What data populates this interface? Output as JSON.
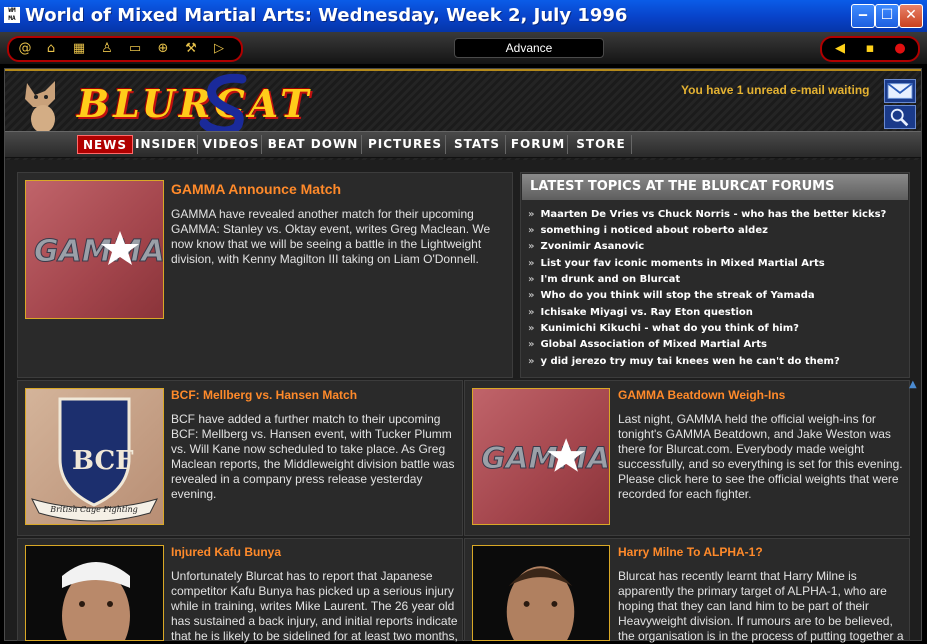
{
  "window": {
    "title": "World of Mixed Martial Arts: Wednesday, Week 2, July 1996",
    "app_icon_text": "WM MA",
    "minimize": "‒",
    "maximize": "☐",
    "close": "✕"
  },
  "toolbar": {
    "left_icons": [
      "at-icon",
      "home-icon",
      "building-icon",
      "person-icon",
      "monitor-icon",
      "globe-icon",
      "tools-icon",
      "play-icon"
    ],
    "left_glyphs": [
      "@",
      "⌂",
      "▦",
      "♙",
      "▭",
      "⊕",
      "⚒",
      "▷"
    ],
    "advance_label": "Advance",
    "right_glyphs": [
      "◀",
      "▪",
      "●"
    ]
  },
  "banner": {
    "logo_text": "BLURCAT",
    "email_notice": "You have 1 unread e-mail waiting"
  },
  "nav": {
    "items": [
      "NEWS",
      "INSIDER",
      "VIDEOS",
      "BEAT DOWN",
      "PICTURES",
      "STATS",
      "FORUM",
      "STORE"
    ],
    "active_index": 0
  },
  "thumbs": {
    "gamma_text": "GAMMA",
    "bcf_text": "BCF",
    "bcf_banner": "British Cage Fighting"
  },
  "articles": [
    {
      "headline": "GAMMA Announce Match",
      "body": "GAMMA have revealed another match for their upcoming GAMMA: Stanley vs. Oktay event, writes Greg Maclean. We now know that we will be seeing a battle in the Lightweight division, with Kenny Magilton III taking on Liam O'Donnell."
    },
    {
      "headline": "BCF: Mellberg vs. Hansen Match",
      "body": "BCF have added a further match to their upcoming BCF: Mellberg vs. Hansen event, with Tucker Plumm vs. Will Kane now scheduled to take place. As Greg Maclean reports, the Middleweight division battle was revealed in a company press release yesterday evening."
    },
    {
      "headline": "GAMMA Beatdown Weigh-Ins",
      "body": "Last night, GAMMA held the official weigh-ins for tonight's GAMMA Beatdown, and Jake Weston was there for Blurcat.com. Everybody made weight successfully, and so everything is set for this evening. Please click here to see the official weights that were recorded for each fighter."
    },
    {
      "headline": "Injured Kafu Bunya",
      "body": "Unfortunately Blurcat has to report that Japanese competitor Kafu Bunya has picked up a serious injury while in training, writes Mike Laurent. The 26 year old has sustained a back injury, and initial reports indicate that he is likely to be sidelined for at least two months,"
    },
    {
      "headline": "Harry Milne To ALPHA-1?",
      "body": "Blurcat has recently learnt that Harry Milne is apparently the primary target of ALPHA-1, who are hoping that they can land him to be part of their Heavyweight division. If rumours are to be believed, the organisation is in the process of putting together a"
    }
  ],
  "forum": {
    "heading": "LATEST TOPICS AT THE BLURCAT FORUMS",
    "bullet": "»",
    "topics": [
      "Maarten De Vries vs Chuck Norris - who has the better kicks?",
      "something i noticed about roberto aldez",
      "Zvonimir Asanovic",
      "List your fav iconic moments in Mixed Martial Arts",
      "I'm drunk and on Blurcat",
      "Who do you think will stop the streak of Yamada",
      "Ichisake Miyagi vs. Ray Eton question",
      "Kunimichi Kikuchi - what do you think of him?",
      "Global Association of Mixed Martial Arts",
      "y did jerezo try muy tai knees wen he can't do them?"
    ]
  }
}
